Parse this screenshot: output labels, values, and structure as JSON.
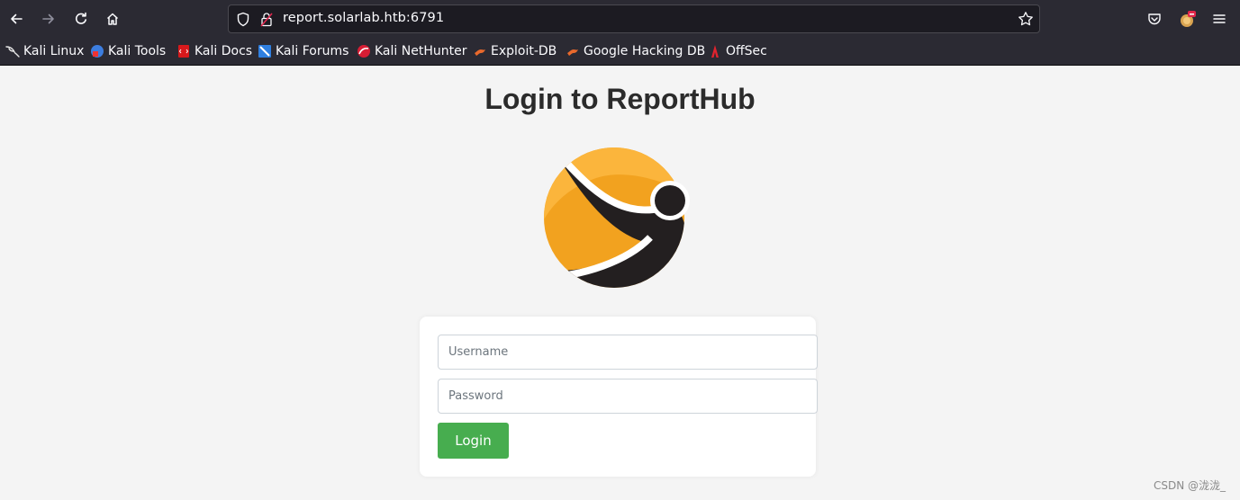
{
  "browser": {
    "url": "report.solarlab.htb:6791",
    "bookmarks": [
      {
        "label": "Kali Linux",
        "icon": "kali-dragon-icon"
      },
      {
        "label": "Kali Tools",
        "icon": "kali-tools-icon"
      },
      {
        "label": "Kali Docs",
        "icon": "kali-docs-icon"
      },
      {
        "label": "Kali Forums",
        "icon": "kali-forums-icon"
      },
      {
        "label": "Kali NetHunter",
        "icon": "kali-nethunter-icon"
      },
      {
        "label": "Exploit-DB",
        "icon": "exploit-db-icon"
      },
      {
        "label": "Google Hacking DB",
        "icon": "ghdb-icon"
      },
      {
        "label": "OffSec",
        "icon": "offsec-icon"
      }
    ]
  },
  "page": {
    "title": "Login to ReportHub",
    "logo": "reporthub-logo",
    "form": {
      "username_placeholder": "Username",
      "password_placeholder": "Password",
      "login_label": "Login"
    }
  },
  "watermark": "CSDN @泷泷_",
  "colors": {
    "chrome_bg": "#2b2a33",
    "page_bg": "#f4f4f4",
    "login_button": "#47ad4f",
    "logo_orange": "#f5a623",
    "logo_dark": "#231f20"
  }
}
